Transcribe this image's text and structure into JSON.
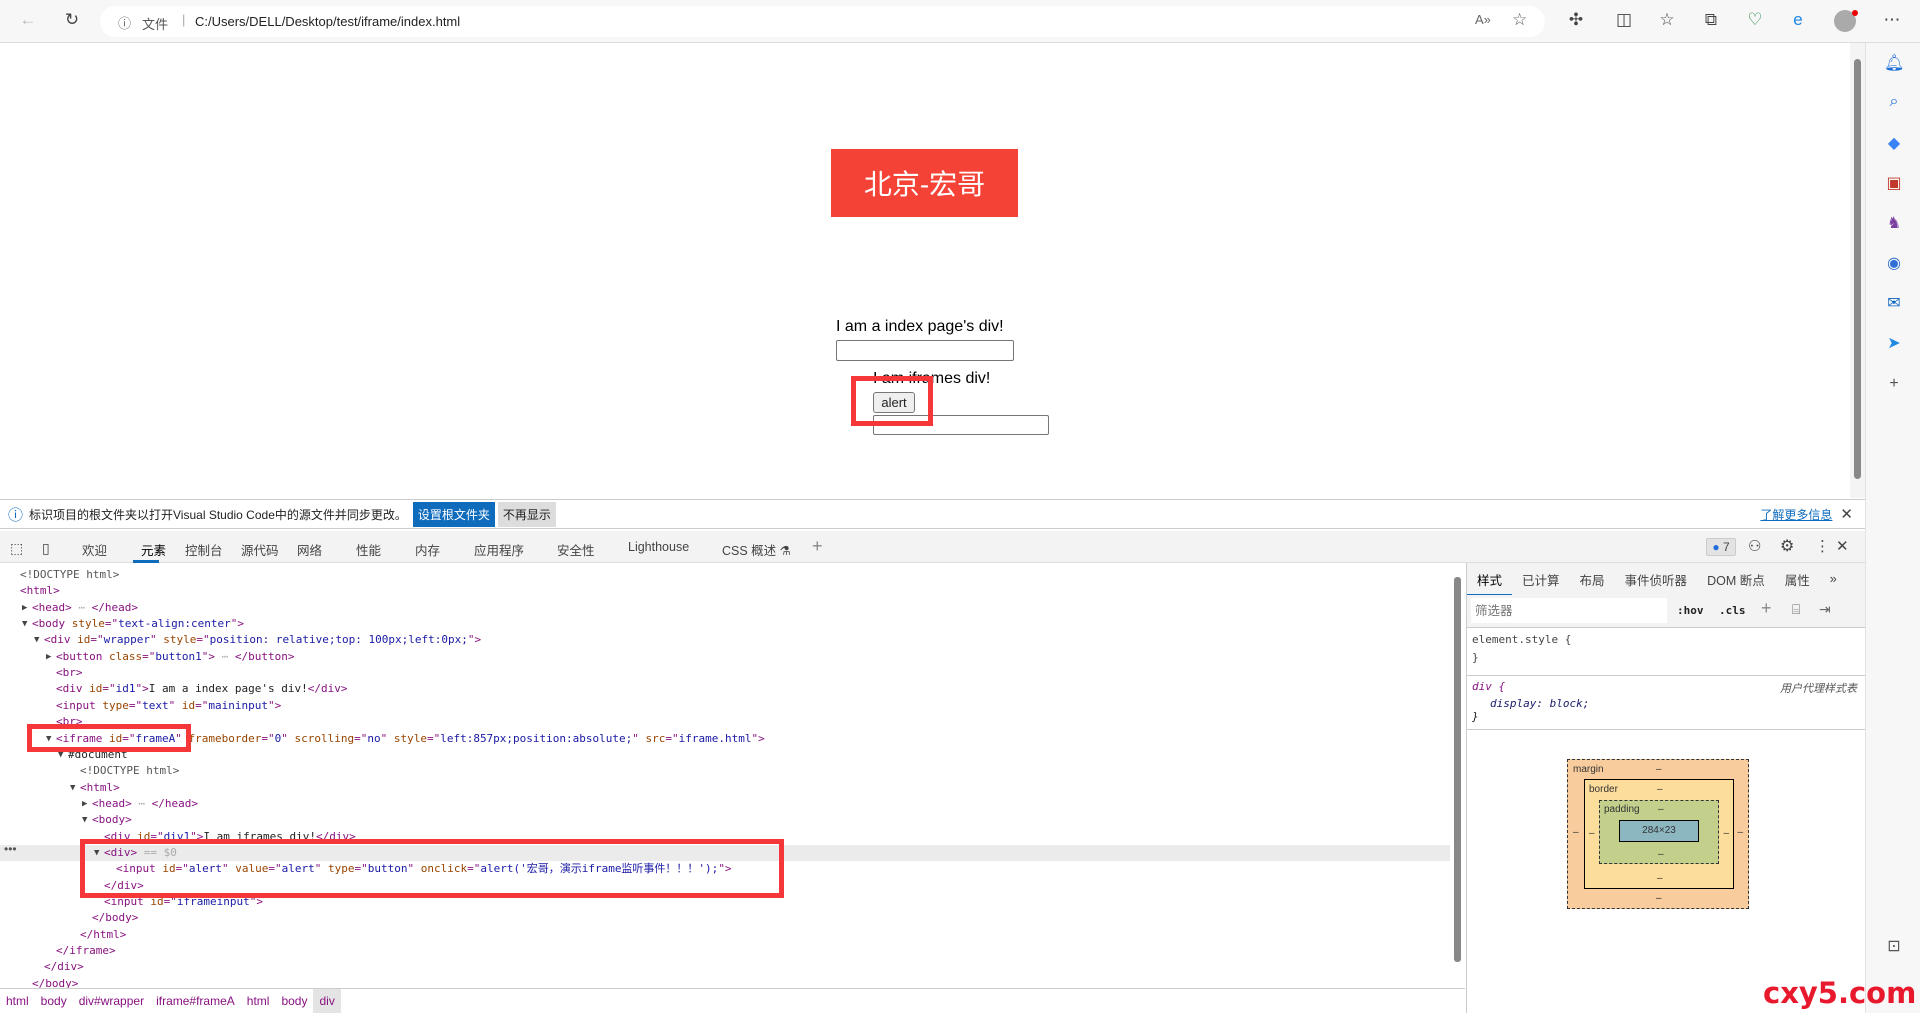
{
  "browser": {
    "url_prefix": "文件",
    "url": "C:/Users/DELL/Desktop/test/iframe/index.html"
  },
  "page": {
    "banner": "北京-宏哥",
    "index_div": "I am a index page's div!",
    "iframe_div": "I am iframes div!",
    "alert_button": "alert"
  },
  "infobar": {
    "message": "标识项目的根文件夹以打开Visual Studio Code中的源文件并同步更改。",
    "set_root": "设置根文件夹",
    "dont_show": "不再显示",
    "learn_more": "了解更多信息"
  },
  "devtools": {
    "tabs": [
      "欢迎",
      "元素",
      "控制台",
      "源代码",
      "网络",
      "性能",
      "内存",
      "应用程序",
      "安全性",
      "Lighthouse",
      "CSS 概述 ⚗"
    ],
    "issues_count": "7",
    "lines": [
      {
        "l": 0,
        "t": [
          [
            "dt",
            "<!DOCTYPE html>"
          ]
        ]
      },
      {
        "l": 0,
        "t": [
          [
            "tg",
            "<html>"
          ]
        ]
      },
      {
        "l": 1,
        "a": "▶",
        "t": [
          [
            "tg",
            "<head>"
          ],
          [
            "cm",
            " ⋯ "
          ],
          [
            "tg",
            "</head>"
          ]
        ]
      },
      {
        "l": 1,
        "a": "▼",
        "t": [
          [
            "tg",
            "<body "
          ],
          [
            "an",
            "style"
          ],
          [
            "tg",
            "=\""
          ],
          [
            "av",
            "text-align:center"
          ],
          [
            "tg",
            "\">"
          ]
        ]
      },
      {
        "l": 2,
        "a": "▼",
        "t": [
          [
            "tg",
            "<div "
          ],
          [
            "an",
            "id"
          ],
          [
            "tg",
            "=\""
          ],
          [
            "av",
            "wrapper"
          ],
          [
            "tg",
            "\" "
          ],
          [
            "an",
            "style"
          ],
          [
            "tg",
            "=\""
          ],
          [
            "av",
            "position: relative;top: 100px;left:0px;"
          ],
          [
            "tg",
            "\">"
          ]
        ]
      },
      {
        "l": 3,
        "a": "▶",
        "t": [
          [
            "tg",
            "<button "
          ],
          [
            "an",
            "class"
          ],
          [
            "tg",
            "=\""
          ],
          [
            "av",
            "button1"
          ],
          [
            "tg",
            "\">"
          ],
          [
            "cm",
            " ⋯ "
          ],
          [
            "tg",
            "</button>"
          ]
        ]
      },
      {
        "l": 3,
        "t": [
          [
            "tg",
            "<br>"
          ]
        ]
      },
      {
        "l": 3,
        "t": [
          [
            "tg",
            "<div "
          ],
          [
            "an",
            "id"
          ],
          [
            "tg",
            "=\""
          ],
          [
            "av",
            "id1"
          ],
          [
            "tg",
            "\">"
          ],
          [
            "tx",
            "I am a index page's div!"
          ],
          [
            "tg",
            "</div>"
          ]
        ]
      },
      {
        "l": 3,
        "t": [
          [
            "tg",
            "<input "
          ],
          [
            "an",
            "type"
          ],
          [
            "tg",
            "=\""
          ],
          [
            "av",
            "text"
          ],
          [
            "tg",
            "\" "
          ],
          [
            "an",
            "id"
          ],
          [
            "tg",
            "=\""
          ],
          [
            "av",
            "maininput"
          ],
          [
            "tg",
            "\">"
          ]
        ]
      },
      {
        "l": 3,
        "t": [
          [
            "tg",
            "<br>"
          ]
        ]
      },
      {
        "l": 3,
        "a": "▼",
        "t": [
          [
            "tg",
            "<iframe "
          ],
          [
            "an",
            "id"
          ],
          [
            "tg",
            "=\""
          ],
          [
            "av",
            "frameA"
          ],
          [
            "tg",
            "\" "
          ],
          [
            "an",
            "frameborder"
          ],
          [
            "tg",
            "=\""
          ],
          [
            "av",
            "0"
          ],
          [
            "tg",
            "\" "
          ],
          [
            "an",
            "scrolling"
          ],
          [
            "tg",
            "=\""
          ],
          [
            "av",
            "no"
          ],
          [
            "tg",
            "\" "
          ],
          [
            "an",
            "style"
          ],
          [
            "tg",
            "=\""
          ],
          [
            "av",
            "left:857px;position:absolute;"
          ],
          [
            "tg",
            "\" "
          ],
          [
            "an",
            "src"
          ],
          [
            "tg",
            "=\""
          ],
          [
            "av",
            "iframe.html"
          ],
          [
            "tg",
            "\">"
          ]
        ]
      },
      {
        "l": 4,
        "a": "▼",
        "t": [
          [
            "tx",
            "#document"
          ]
        ]
      },
      {
        "l": 5,
        "t": [
          [
            "dt",
            "<!DOCTYPE html>"
          ]
        ]
      },
      {
        "l": 5,
        "a": "▼",
        "t": [
          [
            "tg",
            "<html>"
          ]
        ]
      },
      {
        "l": 6,
        "a": "▶",
        "t": [
          [
            "tg",
            "<head>"
          ],
          [
            "cm",
            " ⋯ "
          ],
          [
            "tg",
            "</head>"
          ]
        ]
      },
      {
        "l": 6,
        "a": "▼",
        "t": [
          [
            "tg",
            "<body>"
          ]
        ]
      },
      {
        "l": 7,
        "t": [
          [
            "tg",
            "<div "
          ],
          [
            "an",
            "id"
          ],
          [
            "tg",
            "=\""
          ],
          [
            "av",
            "div1"
          ],
          [
            "tg",
            "\">"
          ],
          [
            "tx",
            "I am iframes div!"
          ],
          [
            "tg",
            "</div>"
          ]
        ]
      },
      {
        "l": 7,
        "a": "▼",
        "sel": true,
        "t": [
          [
            "tg",
            "<div>"
          ],
          [
            "cm",
            " == $0"
          ]
        ]
      },
      {
        "l": 8,
        "t": [
          [
            "tg",
            "<input "
          ],
          [
            "an",
            "id"
          ],
          [
            "tg",
            "=\""
          ],
          [
            "av",
            "alert"
          ],
          [
            "tg",
            "\" "
          ],
          [
            "an",
            "value"
          ],
          [
            "tg",
            "=\""
          ],
          [
            "av",
            "alert"
          ],
          [
            "tg",
            "\" "
          ],
          [
            "an",
            "type"
          ],
          [
            "tg",
            "=\""
          ],
          [
            "av",
            "button"
          ],
          [
            "tg",
            "\" "
          ],
          [
            "an",
            "onclick"
          ],
          [
            "tg",
            "=\""
          ],
          [
            "av",
            "alert('宏哥，演示iframe监听事件！！！');"
          ],
          [
            "tg",
            "\">"
          ]
        ]
      },
      {
        "l": 7,
        "t": [
          [
            "tg",
            "</div>"
          ]
        ]
      },
      {
        "l": 7,
        "t": [
          [
            "tg",
            "<input "
          ],
          [
            "an",
            "id"
          ],
          [
            "tg",
            "=\""
          ],
          [
            "av",
            "iframeinput"
          ],
          [
            "tg",
            "\">"
          ]
        ]
      },
      {
        "l": 6,
        "t": [
          [
            "tg",
            "</body>"
          ]
        ]
      },
      {
        "l": 5,
        "t": [
          [
            "tg",
            "</html>"
          ]
        ]
      },
      {
        "l": 3,
        "t": [
          [
            "tg",
            "</iframe>"
          ]
        ]
      },
      {
        "l": 2,
        "t": [
          [
            "tg",
            "</div>"
          ]
        ]
      },
      {
        "l": 1,
        "t": [
          [
            "tg",
            "</body>"
          ]
        ]
      }
    ],
    "breadcrumbs": [
      "html",
      "body",
      "div#wrapper",
      "iframe#frameA",
      "html",
      "body",
      "div"
    ],
    "styles": {
      "tabs": [
        "样式",
        "已计算",
        "布局",
        "事件侦听器",
        "DOM 断点",
        "属性"
      ],
      "filter_placeholder": "筛选器",
      "hov": ":hov",
      "cls": ".cls",
      "rule1_selector": "element.style {",
      "rule_close": "}",
      "rule2_selector": "div {",
      "rule2_source": "用户代理样式表",
      "rule2_decl": "display: block;"
    },
    "box_model": {
      "margin": "margin",
      "border": "border",
      "padding": "padding",
      "content": "284×23",
      "dash": "–"
    }
  },
  "watermark": "cxy5.com"
}
